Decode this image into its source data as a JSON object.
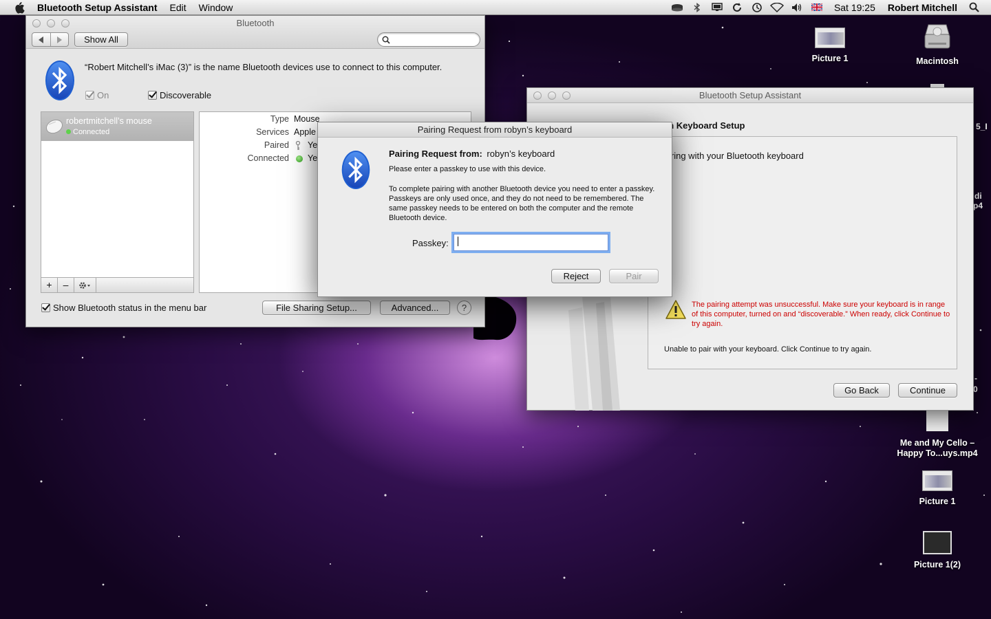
{
  "menubar": {
    "apple_icon": "apple-logo-icon",
    "app_name": "Bluetooth Setup Assistant",
    "items": [
      "Edit",
      "Window"
    ],
    "clock": "Sat 19:25",
    "user": "Robert Mitchell",
    "status_icons": [
      "time-capsule-icon",
      "bluetooth-icon",
      "display-icon",
      "sync-icon",
      "time-machine-icon",
      "wifi-icon",
      "volume-icon",
      "uk-flag-icon",
      "spotlight-icon"
    ]
  },
  "desktop": {
    "icons": [
      {
        "label": "Picture 1",
        "kind": "screenshot-thumbnail-icon"
      },
      {
        "label": "Macintosh",
        "kind": "hard-drive-icon"
      },
      {
        "label": "Me and My Cello – Happy To...uys.mp4",
        "kind": "movie-file-icon"
      },
      {
        "label": "Picture 1",
        "kind": "screenshot-thumbnail-icon"
      },
      {
        "label": "Picture 1(2)",
        "kind": "black-image-icon"
      }
    ],
    "partial_labels": [
      "5_I",
      "di",
      "p4",
      "-",
      "0"
    ]
  },
  "bt_prefs": {
    "title": "Bluetooth",
    "show_all": "Show All",
    "search_placeholder": "",
    "name_message": "“Robert Mitchell’s iMac (3)” is the name Bluetooth devices use to connect to this computer.",
    "on_label": "On",
    "discoverable_label": "Discoverable",
    "device": {
      "name": "robertmitchell’s mouse",
      "status": "Connected"
    },
    "details": [
      {
        "key": "Type",
        "value": "Mouse"
      },
      {
        "key": "Services",
        "value": "Apple"
      },
      {
        "key": "Paired",
        "value": "Ye"
      },
      {
        "key": "Connected",
        "value": "Ye"
      }
    ],
    "add": "+",
    "remove": "–",
    "show_status_label": "Show Bluetooth status in the menu bar",
    "file_sharing": "File Sharing Setup...",
    "advanced": "Advanced...",
    "help": "?"
  },
  "assistant": {
    "title": "Bluetooth Setup Assistant",
    "heading": "ooth Keyboard Setup",
    "subheading": "iring with your Bluetooth keyboard",
    "warning": "The pairing attempt was unsuccessful. Make sure your keyboard is in range of this computer, turned on and “discoverable.” When ready, click Continue to try again.",
    "unable": "Unable to pair with your keyboard. Click Continue to try again.",
    "go_back": "Go Back",
    "continue": "Continue",
    "warning_color": "#cc0000"
  },
  "pairing": {
    "title": "Pairing Request from robyn’s keyboard",
    "from_label": "Pairing Request from:",
    "from_device": "robyn’s keyboard",
    "line1": "Please enter a passkey to use with this device.",
    "line2": "To complete pairing with another Bluetooth device you need to enter a passkey.  Passkeys are only used once, and they do not need to be remembered.  The same passkey needs to be entered on both the computer and the remote Bluetooth device.",
    "passkey_label": "Passkey:",
    "passkey_value": "",
    "reject": "Reject",
    "pair": "Pair"
  }
}
